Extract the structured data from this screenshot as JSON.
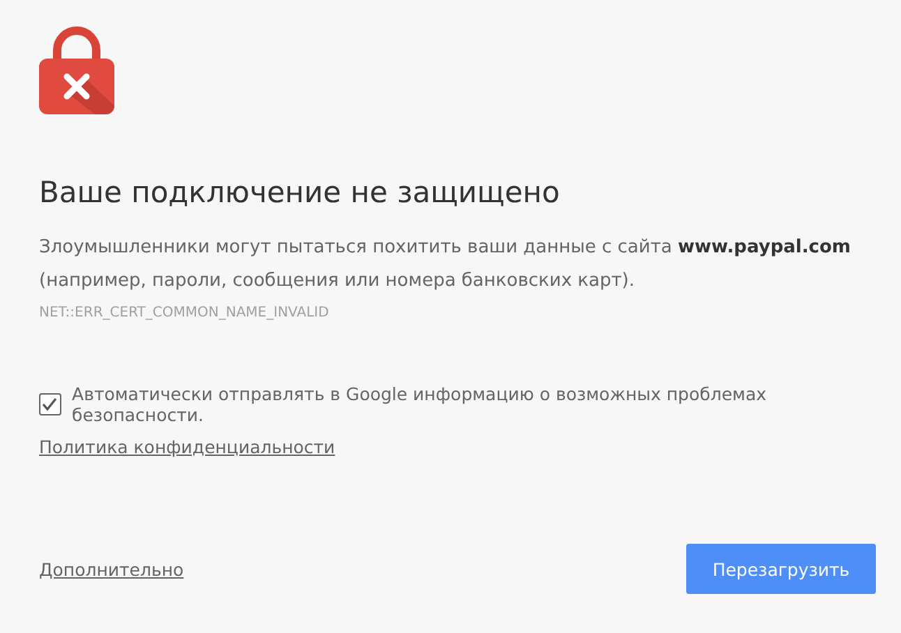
{
  "heading": "Ваше подключение не защищено",
  "message": "Злоумышленники могут пытаться похитить ваши данные с сайта **www.paypal.com** (например, пароли, сообщения или номера банковских карт).",
  "error_code": "NET::ERR_CERT_COMMON_NAME_INVALID",
  "report": {
    "label": "Автоматически отправлять в Google информацию о возможных проблемах безопасности.",
    "checked": true
  },
  "privacy_link": "Политика конфиденциальности",
  "details_link": "Дополнительно",
  "reload_button": "Перезагрузить"
}
